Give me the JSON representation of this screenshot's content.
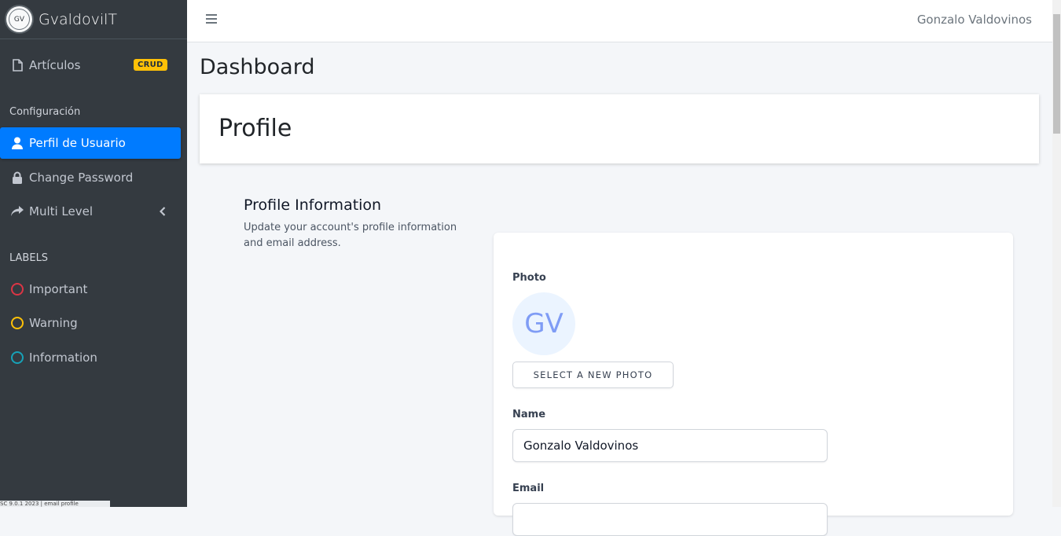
{
  "brand": {
    "logo_text": "GV",
    "name": "GvaldovilT"
  },
  "sidebar": {
    "items": [
      {
        "label": "Artículos",
        "badge": "CRUD",
        "icon": "file-icon"
      }
    ],
    "config_header": "Configuración",
    "config_items": [
      {
        "label": "Perfil de Usuario",
        "icon": "user-icon",
        "active": true
      },
      {
        "label": "Change Password",
        "icon": "lock-icon"
      },
      {
        "label": "Multi Level",
        "icon": "share-icon"
      }
    ],
    "labels_header": "LABELS",
    "labels": [
      {
        "label": "Important",
        "color": "#dc3545"
      },
      {
        "label": "Warning",
        "color": "#ffc107"
      },
      {
        "label": "Information",
        "color": "#17a2b8"
      }
    ],
    "footer": "SC 9.0.1 2023 | email profile"
  },
  "topbar": {
    "user_name": "Gonzalo Valdovinos"
  },
  "page": {
    "title": "Dashboard",
    "card_title": "Profile"
  },
  "profile_section": {
    "title": "Profile Information",
    "description": "Update your account's profile information and email address."
  },
  "form": {
    "photo_label": "Photo",
    "avatar_initials": "GV",
    "select_photo_button": "SELECT A NEW PHOTO",
    "name_label": "Name",
    "name_value": "Gonzalo Valdovinos",
    "email_label": "Email",
    "email_value": ""
  },
  "colors": {
    "sidebar_bg": "#343a40",
    "accent": "#007bff",
    "badge": "#ffc107"
  }
}
